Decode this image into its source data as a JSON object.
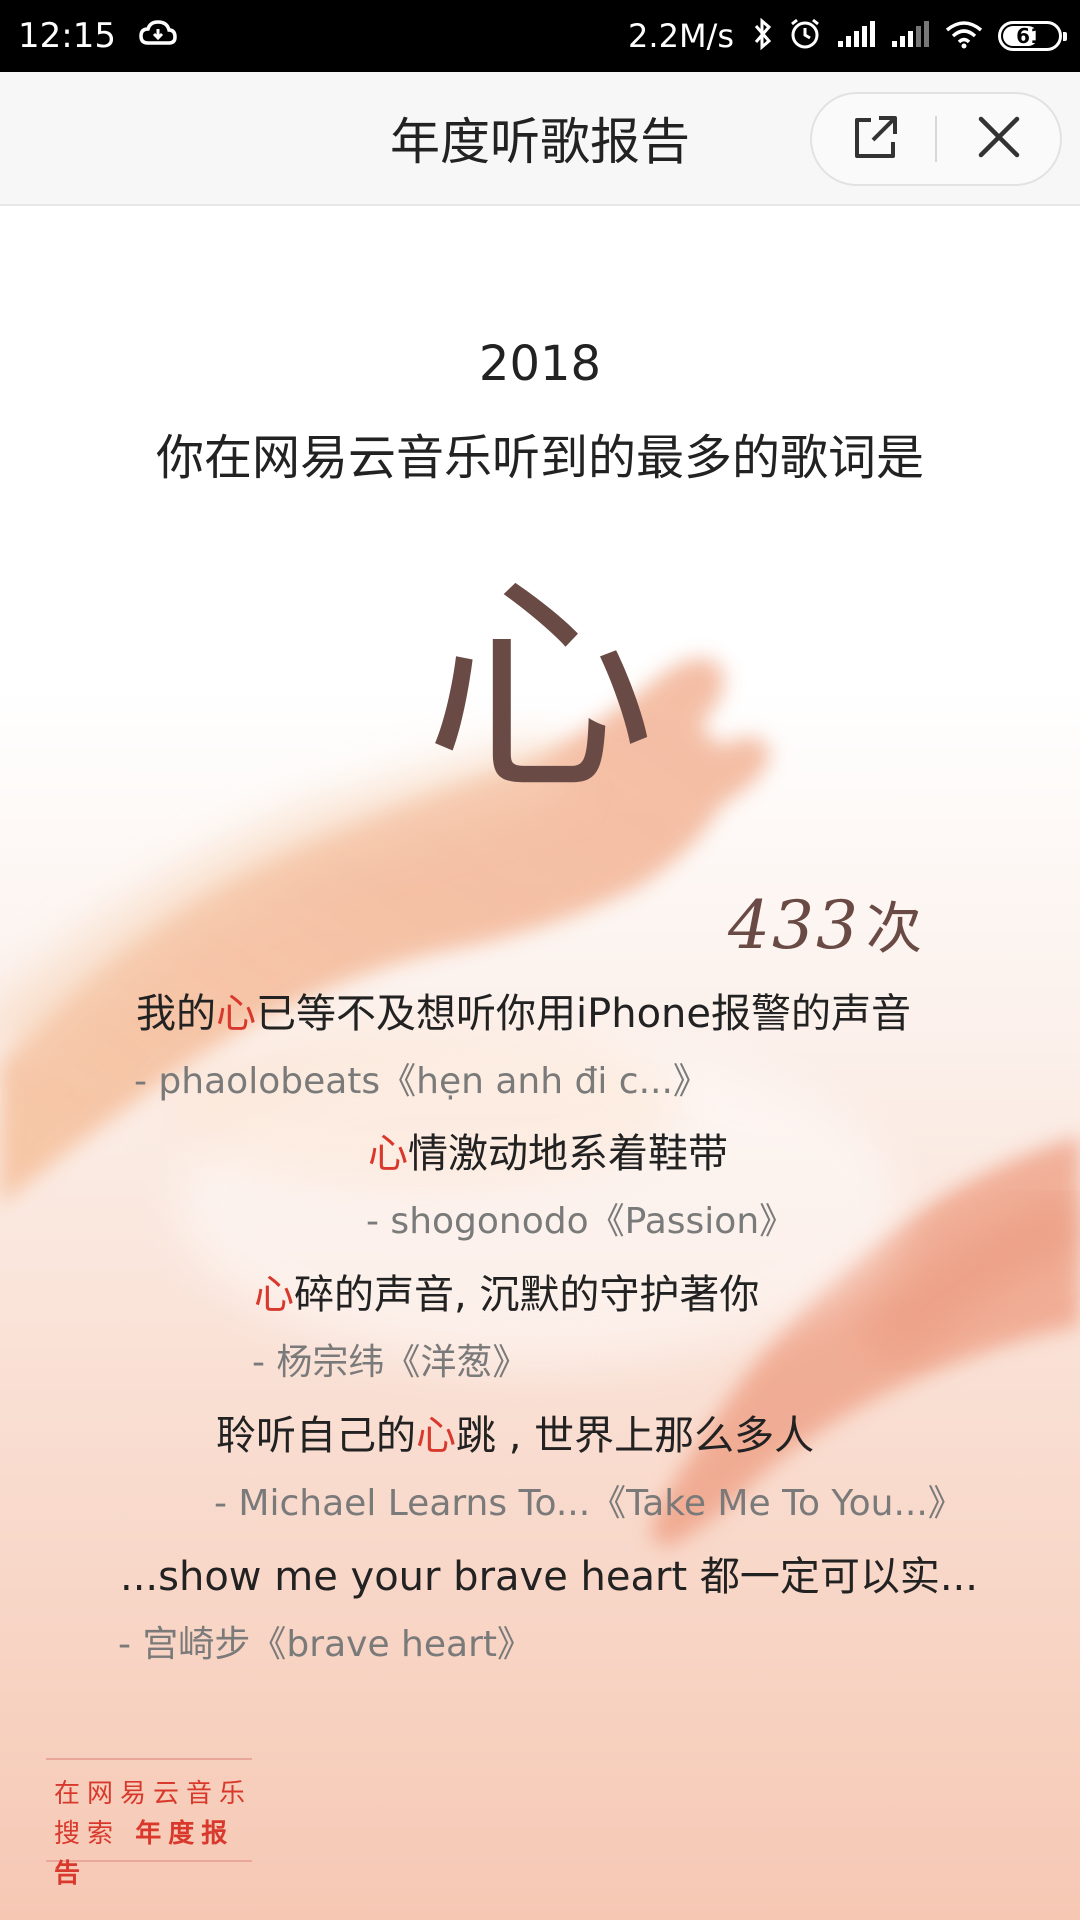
{
  "status_bar": {
    "time": "12:15",
    "speed": "2.2M/s",
    "battery": "61",
    "icons": [
      "cloud-icon",
      "bluetooth-icon",
      "alarm-icon",
      "signal-icon",
      "signal-icon",
      "wifi-icon",
      "battery-icon"
    ]
  },
  "title_bar": {
    "title": "年度听歌报告",
    "share_icon": "share-icon",
    "close_icon": "close-icon"
  },
  "report": {
    "year": "2018",
    "headline": "你在网易云音乐听到的最多的歌词是",
    "keyword": "心",
    "count": "433",
    "count_unit": "次",
    "highlight_color": "#d9392d"
  },
  "lyrics": [
    {
      "before": "我的",
      "highlight": "心",
      "after": "已等不及想听你用iPhone报警的声音",
      "source": "- phaolobeats《hẹn anh đi c...》"
    },
    {
      "before": "",
      "highlight": "心",
      "after": "情激动地系着鞋带",
      "source": "- shogonodo《Passion》"
    },
    {
      "before": "",
      "highlight": "心",
      "after": "碎的声音, 沉默的守护著你",
      "source": "- 杨宗纬《洋葱》"
    },
    {
      "before": "聆听自己的",
      "highlight": "心",
      "after": "跳 , 世界上那么多人",
      "source": "- Michael Learns To...《Take Me To You...》"
    },
    {
      "before": "...show me your brave heart 都一定可以实...",
      "highlight": "",
      "after": "",
      "source": "- 宫崎步《brave heart》"
    }
  ],
  "footer": {
    "line1": "在网易云音乐",
    "line2_prefix": "搜索",
    "line2_strong": "年度报告"
  }
}
